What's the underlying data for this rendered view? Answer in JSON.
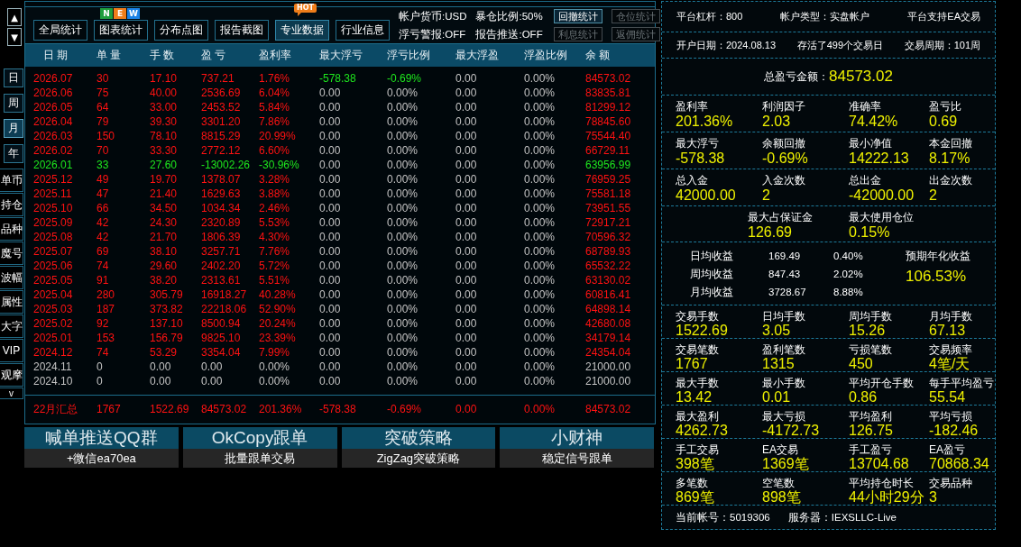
{
  "side_rail": {
    "arrows": [
      "▲",
      "▼"
    ],
    "tabs": [
      {
        "label": "日",
        "selected": false
      },
      {
        "label": "周",
        "selected": false
      },
      {
        "label": "月",
        "selected": true
      },
      {
        "label": "年",
        "selected": false
      }
    ],
    "menu": [
      "单币",
      "持仓",
      "品种",
      "魔号",
      "波幅",
      "属性",
      "大字",
      "VIP",
      "观摩"
    ],
    "more": "v"
  },
  "toolbar": {
    "buttons": [
      {
        "label": "全局统计",
        "selected": false
      },
      {
        "label": "图表统计",
        "selected": false,
        "badge": {
          "kind": "letters",
          "letters": [
            {
              "text": "N",
              "color": "#1e9e3c"
            },
            {
              "text": "E",
              "color": "#ef7d1a"
            },
            {
              "text": "W",
              "color": "#1a82e6"
            }
          ]
        }
      },
      {
        "label": "分布点图",
        "selected": false
      },
      {
        "label": "报告截图",
        "selected": false
      },
      {
        "label": "专业数据",
        "selected": true,
        "badge": {
          "kind": "tag",
          "text": "HOT"
        }
      },
      {
        "label": "行业信息",
        "selected": false
      }
    ],
    "info": [
      "帐户货币:USD",
      "暴仓比例:50%",
      "浮亏警报:OFF",
      "报告推送:OFF"
    ],
    "small_buttons": [
      {
        "label": "回撤统计",
        "disabled": false
      },
      {
        "label": "仓位统计",
        "disabled": true
      },
      {
        "label": "利息统计",
        "disabled": true
      },
      {
        "label": "返佣统计",
        "disabled": true
      }
    ]
  },
  "table": {
    "columns": [
      "日 期",
      "单 量",
      "手 数",
      "盈 亏",
      "盈利率",
      "最大浮亏",
      "浮亏比例",
      "最大浮盈",
      "浮盈比例",
      "余 额"
    ],
    "rows": [
      {
        "cells": [
          "2026.07",
          "30",
          "17.10",
          "737.21",
          "1.76%",
          "-578.38",
          "-0.69%",
          "0.00",
          "0.00%",
          "84573.02"
        ],
        "kind": "profit",
        "floating_loss": true
      },
      {
        "cells": [
          "2026.06",
          "75",
          "40.00",
          "2536.69",
          "6.04%",
          "0.00",
          "0.00%",
          "0.00",
          "0.00%",
          "83835.81"
        ],
        "kind": "profit",
        "floating_loss": false
      },
      {
        "cells": [
          "2026.05",
          "64",
          "33.00",
          "2453.52",
          "5.84%",
          "0.00",
          "0.00%",
          "0.00",
          "0.00%",
          "81299.12"
        ],
        "kind": "profit",
        "floating_loss": false
      },
      {
        "cells": [
          "2026.04",
          "79",
          "39.30",
          "3301.20",
          "7.86%",
          "0.00",
          "0.00%",
          "0.00",
          "0.00%",
          "78845.60"
        ],
        "kind": "profit",
        "floating_loss": false
      },
      {
        "cells": [
          "2026.03",
          "150",
          "78.10",
          "8815.29",
          "20.99%",
          "0.00",
          "0.00%",
          "0.00",
          "0.00%",
          "75544.40"
        ],
        "kind": "profit",
        "floating_loss": false
      },
      {
        "cells": [
          "2026.02",
          "70",
          "33.30",
          "2772.12",
          "6.60%",
          "0.00",
          "0.00%",
          "0.00",
          "0.00%",
          "66729.11"
        ],
        "kind": "profit",
        "floating_loss": false
      },
      {
        "cells": [
          "2026.01",
          "33",
          "27.60",
          "-13002.26",
          "-30.96%",
          "0.00",
          "0.00%",
          "0.00",
          "0.00%",
          "63956.99"
        ],
        "kind": "loss",
        "floating_loss": false
      },
      {
        "cells": [
          "2025.12",
          "49",
          "19.70",
          "1378.07",
          "3.28%",
          "0.00",
          "0.00%",
          "0.00",
          "0.00%",
          "76959.25"
        ],
        "kind": "profit",
        "floating_loss": false
      },
      {
        "cells": [
          "2025.11",
          "47",
          "21.40",
          "1629.63",
          "3.88%",
          "0.00",
          "0.00%",
          "0.00",
          "0.00%",
          "75581.18"
        ],
        "kind": "profit",
        "floating_loss": false
      },
      {
        "cells": [
          "2025.10",
          "66",
          "34.50",
          "1034.34",
          "2.46%",
          "0.00",
          "0.00%",
          "0.00",
          "0.00%",
          "73951.55"
        ],
        "kind": "profit",
        "floating_loss": false
      },
      {
        "cells": [
          "2025.09",
          "42",
          "24.30",
          "2320.89",
          "5.53%",
          "0.00",
          "0.00%",
          "0.00",
          "0.00%",
          "72917.21"
        ],
        "kind": "profit",
        "floating_loss": false
      },
      {
        "cells": [
          "2025.08",
          "42",
          "21.70",
          "1806.39",
          "4.30%",
          "0.00",
          "0.00%",
          "0.00",
          "0.00%",
          "70596.32"
        ],
        "kind": "profit",
        "floating_loss": false
      },
      {
        "cells": [
          "2025.07",
          "69",
          "38.10",
          "3257.71",
          "7.76%",
          "0.00",
          "0.00%",
          "0.00",
          "0.00%",
          "68789.93"
        ],
        "kind": "profit",
        "floating_loss": false
      },
      {
        "cells": [
          "2025.06",
          "74",
          "29.60",
          "2402.20",
          "5.72%",
          "0.00",
          "0.00%",
          "0.00",
          "0.00%",
          "65532.22"
        ],
        "kind": "profit",
        "floating_loss": false
      },
      {
        "cells": [
          "2025.05",
          "91",
          "38.20",
          "2313.61",
          "5.51%",
          "0.00",
          "0.00%",
          "0.00",
          "0.00%",
          "63130.02"
        ],
        "kind": "profit",
        "floating_loss": false
      },
      {
        "cells": [
          "2025.04",
          "280",
          "305.79",
          "16918.27",
          "40.28%",
          "0.00",
          "0.00%",
          "0.00",
          "0.00%",
          "60816.41"
        ],
        "kind": "profit",
        "floating_loss": false
      },
      {
        "cells": [
          "2025.03",
          "187",
          "373.82",
          "22218.06",
          "52.90%",
          "0.00",
          "0.00%",
          "0.00",
          "0.00%",
          "64898.14"
        ],
        "kind": "profit",
        "floating_loss": false
      },
      {
        "cells": [
          "2025.02",
          "92",
          "137.10",
          "8500.94",
          "20.24%",
          "0.00",
          "0.00%",
          "0.00",
          "0.00%",
          "42680.08"
        ],
        "kind": "profit",
        "floating_loss": false
      },
      {
        "cells": [
          "2025.01",
          "153",
          "156.79",
          "9825.10",
          "23.39%",
          "0.00",
          "0.00%",
          "0.00",
          "0.00%",
          "34179.14"
        ],
        "kind": "profit",
        "floating_loss": false
      },
      {
        "cells": [
          "2024.12",
          "74",
          "53.29",
          "3354.04",
          "7.99%",
          "0.00",
          "0.00%",
          "0.00",
          "0.00%",
          "24354.04"
        ],
        "kind": "profit",
        "floating_loss": false
      },
      {
        "cells": [
          "2024.11",
          "0",
          "0.00",
          "0.00",
          "0.00%",
          "0.00",
          "0.00%",
          "0.00",
          "0.00%",
          "21000.00"
        ],
        "kind": "flat",
        "floating_loss": false
      },
      {
        "cells": [
          "2024.10",
          "0",
          "0.00",
          "0.00",
          "0.00%",
          "0.00",
          "0.00%",
          "0.00",
          "0.00%",
          "21000.00"
        ],
        "kind": "flat",
        "floating_loss": false
      }
    ],
    "summary": {
      "cells": [
        "22月汇总",
        "1767",
        "1522.69",
        "84573.02",
        "201.36%",
        "-578.38",
        "-0.69%",
        "0.00",
        "0.00%",
        "84573.02"
      ],
      "kind": "profit"
    }
  },
  "banners": [
    {
      "title": "喊单推送QQ群",
      "subtitle": "+微信ea70ea"
    },
    {
      "title": "OkCopy跟单",
      "subtitle": "批量跟单交易"
    },
    {
      "title": "突破策略",
      "subtitle": "ZigZag突破策略"
    },
    {
      "title": "小财神",
      "subtitle": "稳定信号跟单"
    }
  ],
  "account": {
    "info_rows": [
      [
        "平台杠杆：800",
        "帐户类型：实盘帐户",
        "平台支持EA交易"
      ],
      [
        "开户日期：2024.08.13",
        "存活了499个交易日",
        "交易周期：101周"
      ]
    ],
    "total": {
      "label": "总盈亏金额：",
      "value": "84573.02"
    },
    "performance": [
      [
        {
          "label": "盈利率",
          "value": "201.36%"
        },
        {
          "label": "利润因子",
          "value": "2.03"
        },
        {
          "label": "准确率",
          "value": "74.42%"
        },
        {
          "label": "盈亏比",
          "value": "0.69"
        }
      ],
      [
        {
          "label": "最大浮亏",
          "value": "-578.38"
        },
        {
          "label": "余额回撤",
          "value": "-0.69%"
        },
        {
          "label": "最小净值",
          "value": "14222.13"
        },
        {
          "label": "本金回撤",
          "value": "8.17%"
        }
      ],
      [
        {
          "label": "总入金",
          "value": "42000.00"
        },
        {
          "label": "入金次数",
          "value": "2"
        },
        {
          "label": "总出金",
          "value": "-42000.00"
        },
        {
          "label": "出金次数",
          "value": "2"
        }
      ]
    ],
    "margin": [
      {
        "label": "最大占保证金",
        "value": "126.69"
      },
      {
        "label": "最大使用仓位",
        "value": "0.15%"
      }
    ],
    "averages": {
      "rows": [
        {
          "label": "日均收益",
          "amount": "169.49",
          "percent": "0.40%"
        },
        {
          "label": "周均收益",
          "amount": "847.43",
          "percent": "2.02%"
        },
        {
          "label": "月均收益",
          "amount": "3728.67",
          "percent": "8.88%"
        }
      ],
      "expected": {
        "label": "预期年化收益",
        "value": "106.53%"
      }
    },
    "trading": [
      [
        {
          "label": "交易手数",
          "value": "1522.69"
        },
        {
          "label": "日均手数",
          "value": "3.05"
        },
        {
          "label": "周均手数",
          "value": "15.26"
        },
        {
          "label": "月均手数",
          "value": "67.13"
        }
      ],
      [
        {
          "label": "交易笔数",
          "value": "1767"
        },
        {
          "label": "盈利笔数",
          "value": "1315"
        },
        {
          "label": "亏损笔数",
          "value": "450"
        },
        {
          "label": "交易频率",
          "value": "4笔/天"
        }
      ],
      [
        {
          "label": "最大手数",
          "value": "13.42"
        },
        {
          "label": "最小手数",
          "value": "0.01"
        },
        {
          "label": "平均开仓手数",
          "value": "0.86"
        },
        {
          "label": "每手平均盈亏",
          "value": "55.54"
        }
      ],
      [
        {
          "label": "最大盈利",
          "value": "4262.73"
        },
        {
          "label": "最大亏损",
          "value": "-4172.73"
        },
        {
          "label": "平均盈利",
          "value": "126.75"
        },
        {
          "label": "平均亏损",
          "value": "-182.46"
        }
      ],
      [
        {
          "label": "手工交易",
          "value": "398笔"
        },
        {
          "label": "EA交易",
          "value": "1369笔"
        },
        {
          "label": "手工盈亏",
          "value": "13704.68"
        },
        {
          "label": "EA盈亏",
          "value": "70868.34"
        }
      ],
      [
        {
          "label": "多笔数",
          "value": "869笔"
        },
        {
          "label": "空笔数",
          "value": "898笔"
        },
        {
          "label": "平均持仓时长",
          "value": "44小时29分"
        },
        {
          "label": "交易品种",
          "value": "3"
        }
      ]
    ],
    "footer": [
      "当前帐号：5019306",
      "服务器：IEXSLLC-Live"
    ]
  }
}
